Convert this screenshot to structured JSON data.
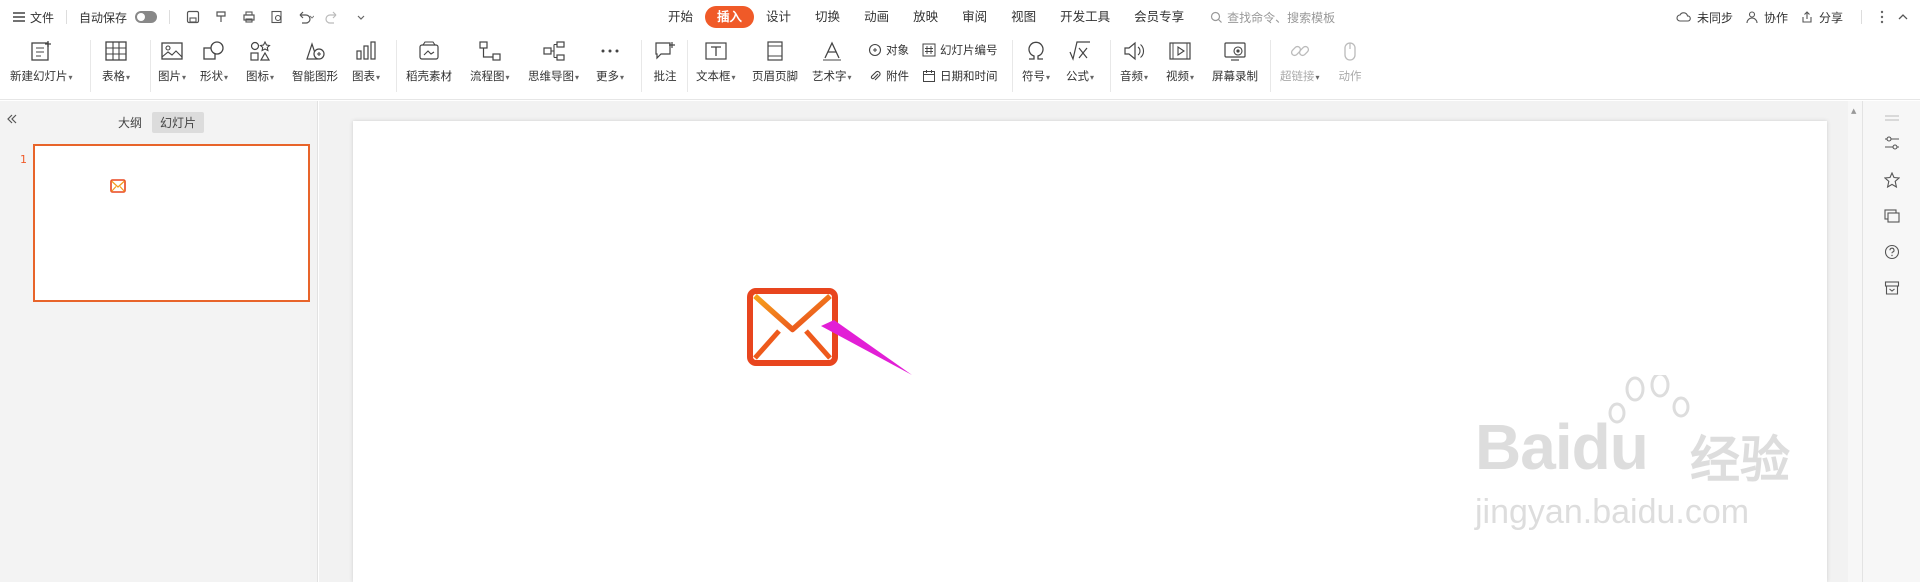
{
  "menubar": {
    "file_label": "文件",
    "autosave_label": "自动保存",
    "tabs": [
      {
        "label": "开始",
        "active": false
      },
      {
        "label": "插入",
        "active": true
      },
      {
        "label": "设计",
        "active": false
      },
      {
        "label": "切换",
        "active": false
      },
      {
        "label": "动画",
        "active": false
      },
      {
        "label": "放映",
        "active": false
      },
      {
        "label": "审阅",
        "active": false
      },
      {
        "label": "视图",
        "active": false
      },
      {
        "label": "开发工具",
        "active": false
      },
      {
        "label": "会员专享",
        "active": false
      }
    ],
    "search_placeholder": "查找命令、搜索模板",
    "right": {
      "sync_label": "未同步",
      "collab_label": "协作",
      "share_label": "分享"
    }
  },
  "ribbon": {
    "new_slide": "新建幻灯片",
    "table": "表格",
    "picture": "图片",
    "shape": "形状",
    "icon": "图标",
    "smartart": "智能图形",
    "chart": "图表",
    "shell_material": "稻壳素材",
    "flowchart": "流程图",
    "mindmap": "思维导图",
    "more": "更多",
    "comment": "批注",
    "textbox": "文本框",
    "header_footer": "页眉页脚",
    "wordart": "艺术字",
    "object": "对象",
    "attachment": "附件",
    "slide_number": "幻灯片编号",
    "date_time": "日期和时间",
    "symbol": "符号",
    "formula": "公式",
    "audio": "音频",
    "video": "视频",
    "screen_record": "屏幕录制",
    "hyperlink": "超链接",
    "action": "动作"
  },
  "left_panel": {
    "outline_tab": "大纲",
    "slides_tab": "幻灯片",
    "slide_number": "1"
  },
  "colors": {
    "accent": "#f05a28",
    "mail_orange_dark": "#e8451e",
    "mail_orange_light": "#f7a21b",
    "arrow": "#e21fd6"
  },
  "watermark": {
    "brand": "Baidu",
    "cn": "经验",
    "url": "jingyan.baidu.com"
  }
}
